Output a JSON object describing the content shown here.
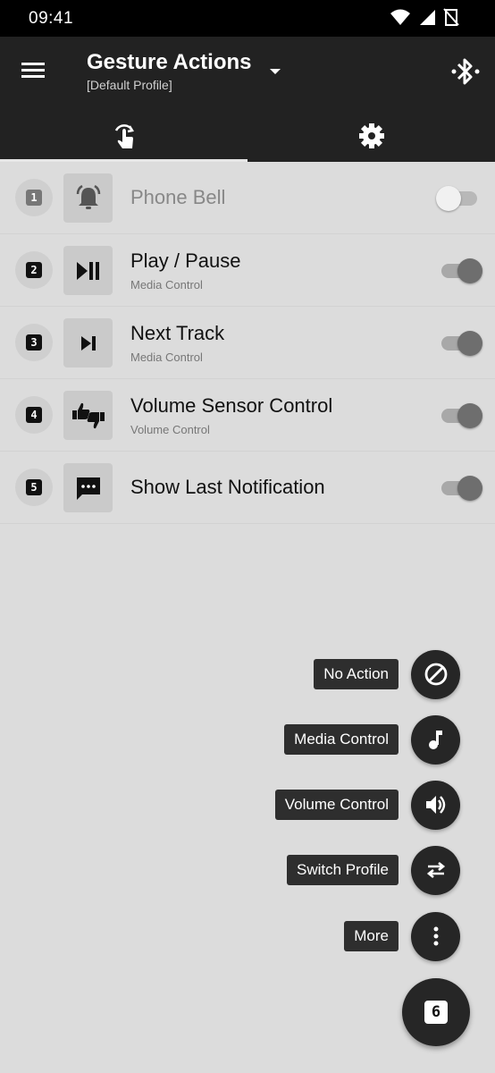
{
  "status_bar": {
    "time": "09:41"
  },
  "app_bar": {
    "title": "Gesture Actions",
    "subtitle": "[Default Profile]"
  },
  "tabs": [
    {
      "icon": "gesture-touch-icon",
      "selected": true
    },
    {
      "icon": "settings-gear-icon",
      "selected": false
    }
  ],
  "actions": [
    {
      "number": "1",
      "icon": "bell-ring-icon",
      "label": "Phone Bell",
      "sublabel": "",
      "enabled": false
    },
    {
      "number": "2",
      "icon": "play-pause-icon",
      "label": "Play / Pause",
      "sublabel": "Media Control",
      "enabled": true
    },
    {
      "number": "3",
      "icon": "skip-next-icon",
      "label": "Next Track",
      "sublabel": "Media Control",
      "enabled": true
    },
    {
      "number": "4",
      "icon": "thumbs-up-down-icon",
      "label": "Volume Sensor Control",
      "sublabel": "Volume Control",
      "enabled": true
    },
    {
      "number": "5",
      "icon": "message-dots-icon",
      "label": "Show Last Notification",
      "sublabel": "",
      "enabled": true
    }
  ],
  "fab_menu": [
    {
      "label": "No Action",
      "icon": "block-icon"
    },
    {
      "label": "Media Control",
      "icon": "music-note-icon"
    },
    {
      "label": "Volume Control",
      "icon": "volume-up-icon"
    },
    {
      "label": "Switch Profile",
      "icon": "swap-arrows-icon"
    },
    {
      "label": "More",
      "icon": "more-vertical-icon"
    }
  ],
  "fab_main": {
    "number": "6"
  },
  "colors": {
    "app_bar": "#222222",
    "background": "#dcdcdc",
    "fab": "#262626"
  }
}
